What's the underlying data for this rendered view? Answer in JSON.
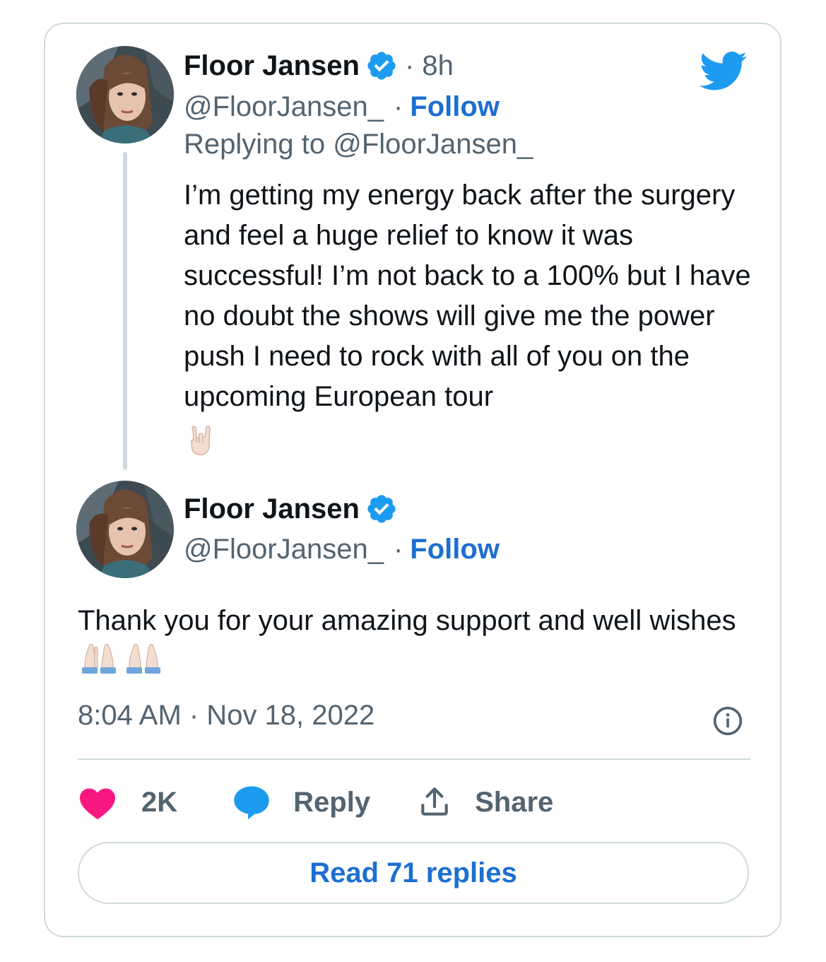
{
  "tweet1": {
    "author_name": "Floor Jansen",
    "time": "· 8h",
    "handle": "@FloorJansen_",
    "separator": "·",
    "follow_label": "Follow",
    "replying_to": "Replying to @FloorJansen_",
    "text": "I’m getting my energy back after the surgery and feel a huge relief to know it was successful! I’m not back to a 100% but I have no doubt the shows will give me the power push I need to rock with all of you on the upcoming European tour",
    "emoji": "rock-on-hand-emoji"
  },
  "tweet2": {
    "author_name": "Floor Jansen",
    "handle": "@FloorJansen_",
    "separator": "·",
    "follow_label": "Follow",
    "text": "Thank you for your amazing support and well wishes",
    "emoji": "folded-hands-emoji",
    "timestamp": "8:04 AM · Nov 18, 2022"
  },
  "actions": {
    "likes_count": "2K",
    "reply_label": "Reply",
    "share_label": "Share"
  },
  "read_replies_label": "Read 71 replies",
  "colors": {
    "accent": "#1d6fd1",
    "twitter_blue": "#1d9bf0",
    "like_pink": "#f91880",
    "muted": "#536471",
    "border": "#cfd9de"
  }
}
